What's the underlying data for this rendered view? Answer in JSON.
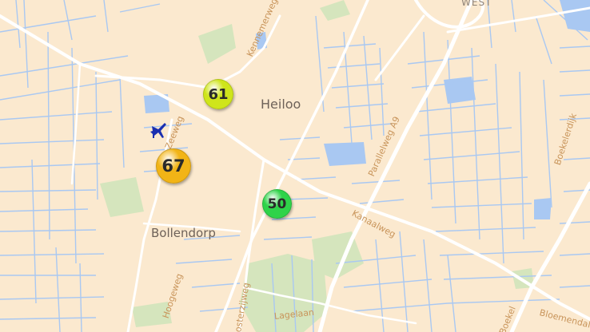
{
  "map": {
    "places": {
      "heiloo": "Heiloo",
      "bollendorp": "Bollendorp",
      "west": "WEST"
    },
    "streets": {
      "kennemerweg": "Kennemerweg",
      "zeeweg": "Zeeweg",
      "parallelweg": "Parallelweg A9",
      "kanaalweg": "Kanaalweg",
      "boekelerdijk": "Boekelerdijk",
      "hoogeweg": "Hoogeweg",
      "oosterzijweg": "Oosterzijweg",
      "lagelaan": "Lagelaan",
      "boekel": "Boekel",
      "bloemendal": "Bloemendal"
    },
    "markers": {
      "m61": {
        "value": "61",
        "color": "#cfe51b"
      },
      "m67": {
        "value": "67",
        "color": "#f2b416"
      },
      "m50": {
        "value": "50",
        "color": "#2fd349"
      }
    },
    "airport_icon": "airplane-icon",
    "colors": {
      "land": "#fbe9cf",
      "water": "#a9c8f2",
      "road": "#ffffff",
      "park": "#d4e4bd",
      "aqi_marker_blue": "#1a2fb0"
    }
  }
}
